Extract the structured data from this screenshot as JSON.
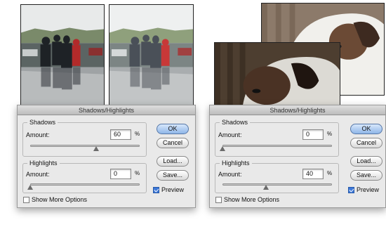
{
  "dialogs": [
    {
      "title": "Shadows/Highlights",
      "shadows": {
        "legend": "Shadows",
        "amount_label": "Amount:",
        "amount": "60",
        "unit": "%",
        "slider_fraction": 0.6
      },
      "highlights": {
        "legend": "Highlights",
        "amount_label": "Amount:",
        "amount": "0",
        "unit": "%",
        "slider_fraction": 0.0
      },
      "buttons": {
        "ok": "OK",
        "cancel": "Cancel",
        "load": "Load...",
        "save": "Save..."
      },
      "preview_label": "Preview",
      "preview_checked": true,
      "show_more_label": "Show More Options",
      "show_more_checked": false
    },
    {
      "title": "Shadows/Highlights",
      "shadows": {
        "legend": "Shadows",
        "amount_label": "Amount:",
        "amount": "0",
        "unit": "%",
        "slider_fraction": 0.0
      },
      "highlights": {
        "legend": "Highlights",
        "amount_label": "Amount:",
        "amount": "40",
        "unit": "%",
        "slider_fraction": 0.4
      },
      "buttons": {
        "ok": "OK",
        "cancel": "Cancel",
        "load": "Load...",
        "save": "Save..."
      },
      "preview_label": "Preview",
      "preview_checked": true,
      "show_more_label": "Show More Options",
      "show_more_checked": false
    }
  ],
  "colors": {
    "default_button": "#8fb6e8",
    "checkbox_on": "#3d78d8",
    "dialog_bg": "#e9e9e9"
  }
}
